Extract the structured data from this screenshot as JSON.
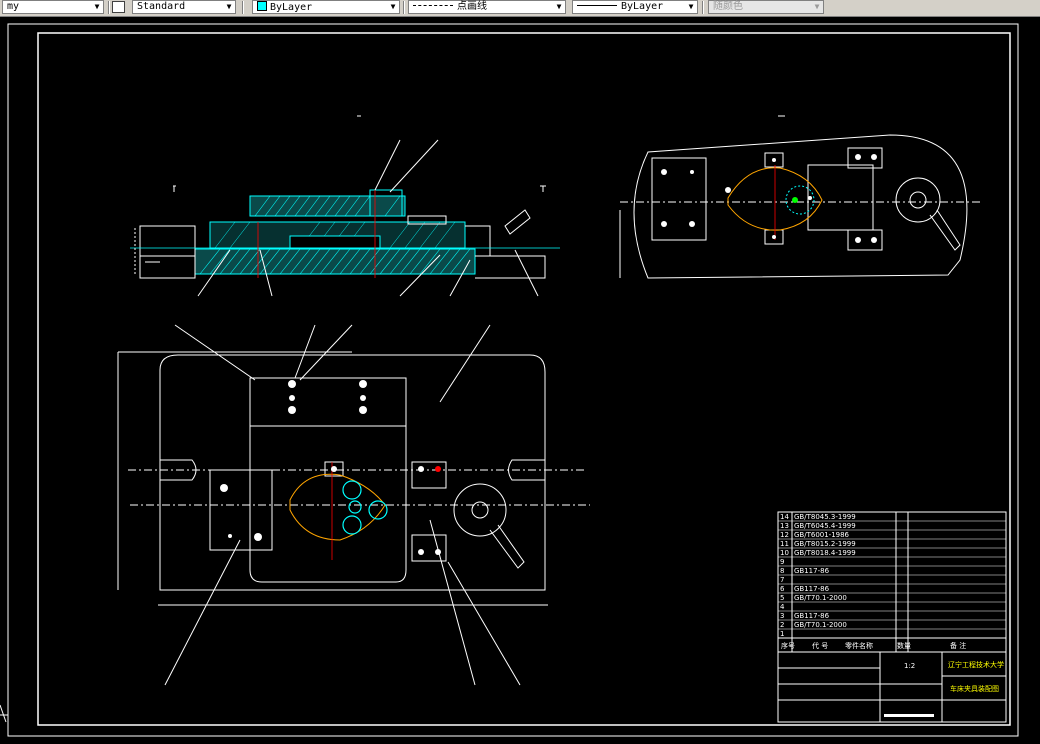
{
  "toolbar": {
    "layer_value": "my",
    "textstyle_value": "Standard",
    "color_value": "ByLayer",
    "linetype_value": "点画线",
    "lineweight_value": "ByLayer",
    "plotstyle_value": "随颜色"
  },
  "title_block": {
    "university": "辽宁工程技术大学",
    "drawing_title": "车床夹具装配图",
    "scale": "1:2",
    "header_seq": "序号",
    "header_code": "代 号",
    "header_name": "零件名称",
    "header_qty": "数量",
    "header_note": "备 注"
  },
  "bom": {
    "rows": [
      {
        "no": "14",
        "code": "GB/T8045.3-1999"
      },
      {
        "no": "13",
        "code": "GB/T6045.4-1999"
      },
      {
        "no": "12",
        "code": "GB/T6001-1986"
      },
      {
        "no": "11",
        "code": "GB/T8015.2-1999"
      },
      {
        "no": "10",
        "code": "GB/T8018.4-1999"
      },
      {
        "no": "9",
        "code": ""
      },
      {
        "no": "8",
        "code": "GB117-86"
      },
      {
        "no": "7",
        "code": ""
      },
      {
        "no": "6",
        "code": "GB117-86"
      },
      {
        "no": "5",
        "code": "GB/T70.1-2000"
      },
      {
        "no": "4",
        "code": ""
      },
      {
        "no": "3",
        "code": "GB117-86"
      },
      {
        "no": "2",
        "code": "GB/T70.1-2000"
      },
      {
        "no": "1",
        "code": ""
      }
    ]
  }
}
